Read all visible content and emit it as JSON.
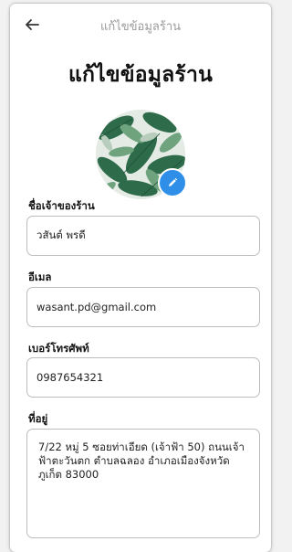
{
  "header": {
    "back_icon": "arrow-left-icon",
    "title": "แก้ไขข้อมูลร้าน"
  },
  "page": {
    "title": "แก้ไขข้อมูลร้าน"
  },
  "avatar": {
    "edit_icon": "pencil-icon",
    "badge_color": "#2f8fe8"
  },
  "form": {
    "owner": {
      "label": "ชื่อเจ้าของร้าน",
      "value": "วสันต์ พรดี"
    },
    "email": {
      "label": "อีเมล",
      "value": "wasant.pd@gmail.com"
    },
    "phone": {
      "label": "เบอร์โทรศัพท์",
      "value": "0987654321"
    },
    "address": {
      "label": "ที่อยู่",
      "value": "7/22 หมู่ 5 ซอยท่าเอียด (เจ้าฟ้า 50) ถนนเจ้าฟ้าตะวันตก ตำบลฉลอง อำเภอเมืองจังหวัดภูเก็ต 83000"
    }
  }
}
